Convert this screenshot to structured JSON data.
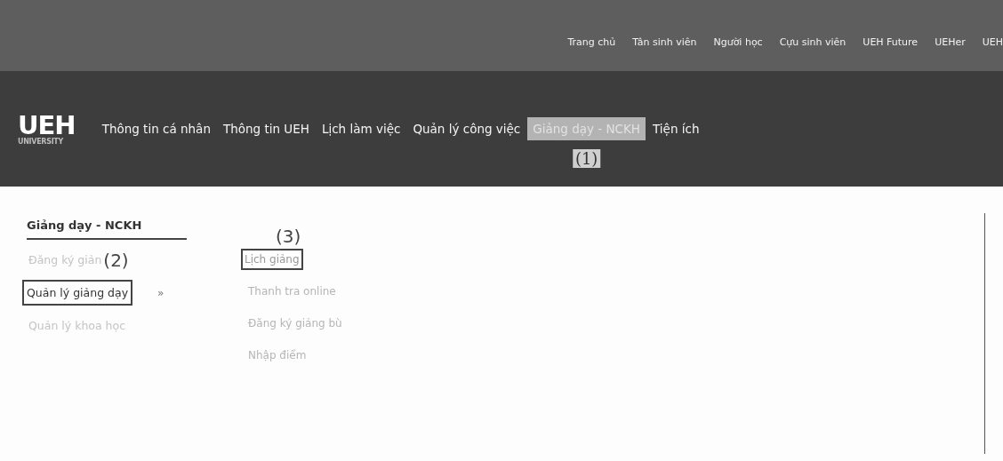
{
  "top_links": [
    "Trang chủ",
    "Tân sinh viên",
    "Người học",
    "Cựu sinh viên",
    "UEH Future",
    "UEHer",
    "UEH"
  ],
  "logo": {
    "mark": "UEH",
    "sub": "UNIVERSITY"
  },
  "nav": [
    {
      "label": "Thông tin cá nhân",
      "selected": false
    },
    {
      "label": "Thông tin UEH",
      "selected": false
    },
    {
      "label": "Lịch làm việc",
      "selected": false
    },
    {
      "label": "Quản lý công việc",
      "selected": false
    },
    {
      "label": "Giảng dạy - NCKH",
      "selected": true,
      "annotation": "(1)"
    },
    {
      "label": "Tiện ích",
      "selected": false
    }
  ],
  "sidebar": {
    "title": "Giảng dạy - NCKH",
    "items": [
      {
        "label": "Đăng ký giản",
        "selected": false,
        "annotation": "(2)"
      },
      {
        "label": "Quản lý giảng dạy",
        "selected": true,
        "chevron": "»"
      },
      {
        "label": "Quản lý khoa học",
        "selected": false
      }
    ]
  },
  "submenu": {
    "annotation": "(3)",
    "items": [
      {
        "label": "Lịch giảng",
        "selected": true
      },
      {
        "label": "Thanh tra online",
        "selected": false
      },
      {
        "label": "Đăng ký giảng bù",
        "selected": false
      },
      {
        "label": "Nhập điểm",
        "selected": false
      }
    ]
  }
}
